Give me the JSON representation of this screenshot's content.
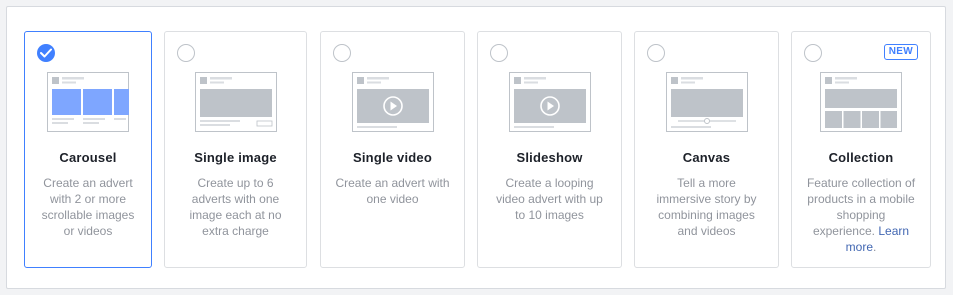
{
  "cards": [
    {
      "title": "Carousel",
      "description": "Create an advert with 2 or more scrollable images or videos",
      "selected": true,
      "thumbnail_icon": "carousel-thumbnail"
    },
    {
      "title": "Single image",
      "description": "Create up to 6 adverts with one image each at no extra charge",
      "selected": false,
      "thumbnail_icon": "single-image-thumbnail"
    },
    {
      "title": "Single video",
      "description": "Create an advert with one video",
      "selected": false,
      "thumbnail_icon": "single-video-thumbnail"
    },
    {
      "title": "Slideshow",
      "description": "Create a looping video advert with up to 10 images",
      "selected": false,
      "thumbnail_icon": "slideshow-thumbnail"
    },
    {
      "title": "Canvas",
      "description": "Tell a more immersive story by combining images and videos",
      "selected": false,
      "thumbnail_icon": "canvas-thumbnail"
    },
    {
      "title": "Collection",
      "description": "Feature collection of products in a mobile shopping experience.",
      "learn_more": "Learn more",
      "badge": "NEW",
      "selected": false,
      "thumbnail_icon": "collection-thumbnail"
    }
  ],
  "colors": {
    "accent": "#4080ff",
    "thumb_blue": "#7ea6ff",
    "thumb_gray": "#bec3c9",
    "link": "#4267b2"
  }
}
